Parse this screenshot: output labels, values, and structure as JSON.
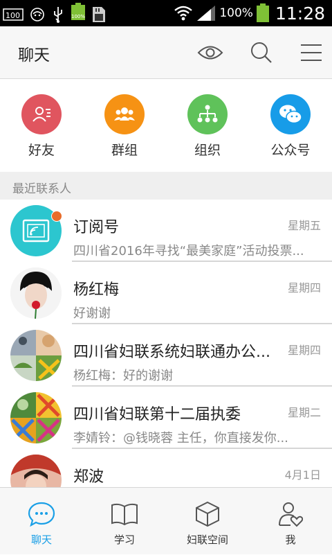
{
  "status_bar": {
    "battery_mini_pct": "100%",
    "battery_percent": "100%",
    "time": "11:28"
  },
  "header": {
    "title": "聊天",
    "icons": [
      "eye-icon",
      "search-icon",
      "menu-icon"
    ]
  },
  "quick_entries": [
    {
      "label": "好友",
      "icon": "friends-icon",
      "color": "#e0555f"
    },
    {
      "label": "群组",
      "icon": "group-icon",
      "color": "#f69214"
    },
    {
      "label": "组织",
      "icon": "organization-icon",
      "color": "#5fc25a"
    },
    {
      "label": "公众号",
      "icon": "wechat-icon",
      "color": "#179ce8"
    }
  ],
  "section_title": "最近联系人",
  "conversations": [
    {
      "name": "订阅号",
      "time": "星期五",
      "preview": "四川省2016年寻找“最美家庭”活动投票...",
      "unread": true,
      "avatar": "subscription-icon"
    },
    {
      "name": "杨红梅",
      "time": "星期四",
      "preview": "好谢谢",
      "unread": false,
      "avatar": "photo"
    },
    {
      "name": "四川省妇联系统妇联通办公...",
      "time": "星期四",
      "preview": "杨红梅：好的谢谢",
      "unread": false,
      "avatar": "group-collage"
    },
    {
      "name": "四川省妇联第十二届执委",
      "time": "星期二",
      "preview": "李婧铃：@钱晓蓉 主任，你直接发你...",
      "unread": false,
      "avatar": "group-collage"
    },
    {
      "name": "郑波",
      "time": "4月1日",
      "preview": "",
      "unread": false,
      "avatar": "photo"
    }
  ],
  "bottom_nav": [
    {
      "label": "聊天",
      "icon": "chat-bubble-icon",
      "active": true
    },
    {
      "label": "学习",
      "icon": "book-icon",
      "active": false
    },
    {
      "label": "妇联空间",
      "icon": "cube-icon",
      "active": false
    },
    {
      "label": "我",
      "icon": "user-heart-icon",
      "active": false
    }
  ],
  "colors": {
    "accent": "#1a9fe6",
    "subscription_avatar": "#2cc6cf",
    "unread_dot": "#e86c2a"
  }
}
